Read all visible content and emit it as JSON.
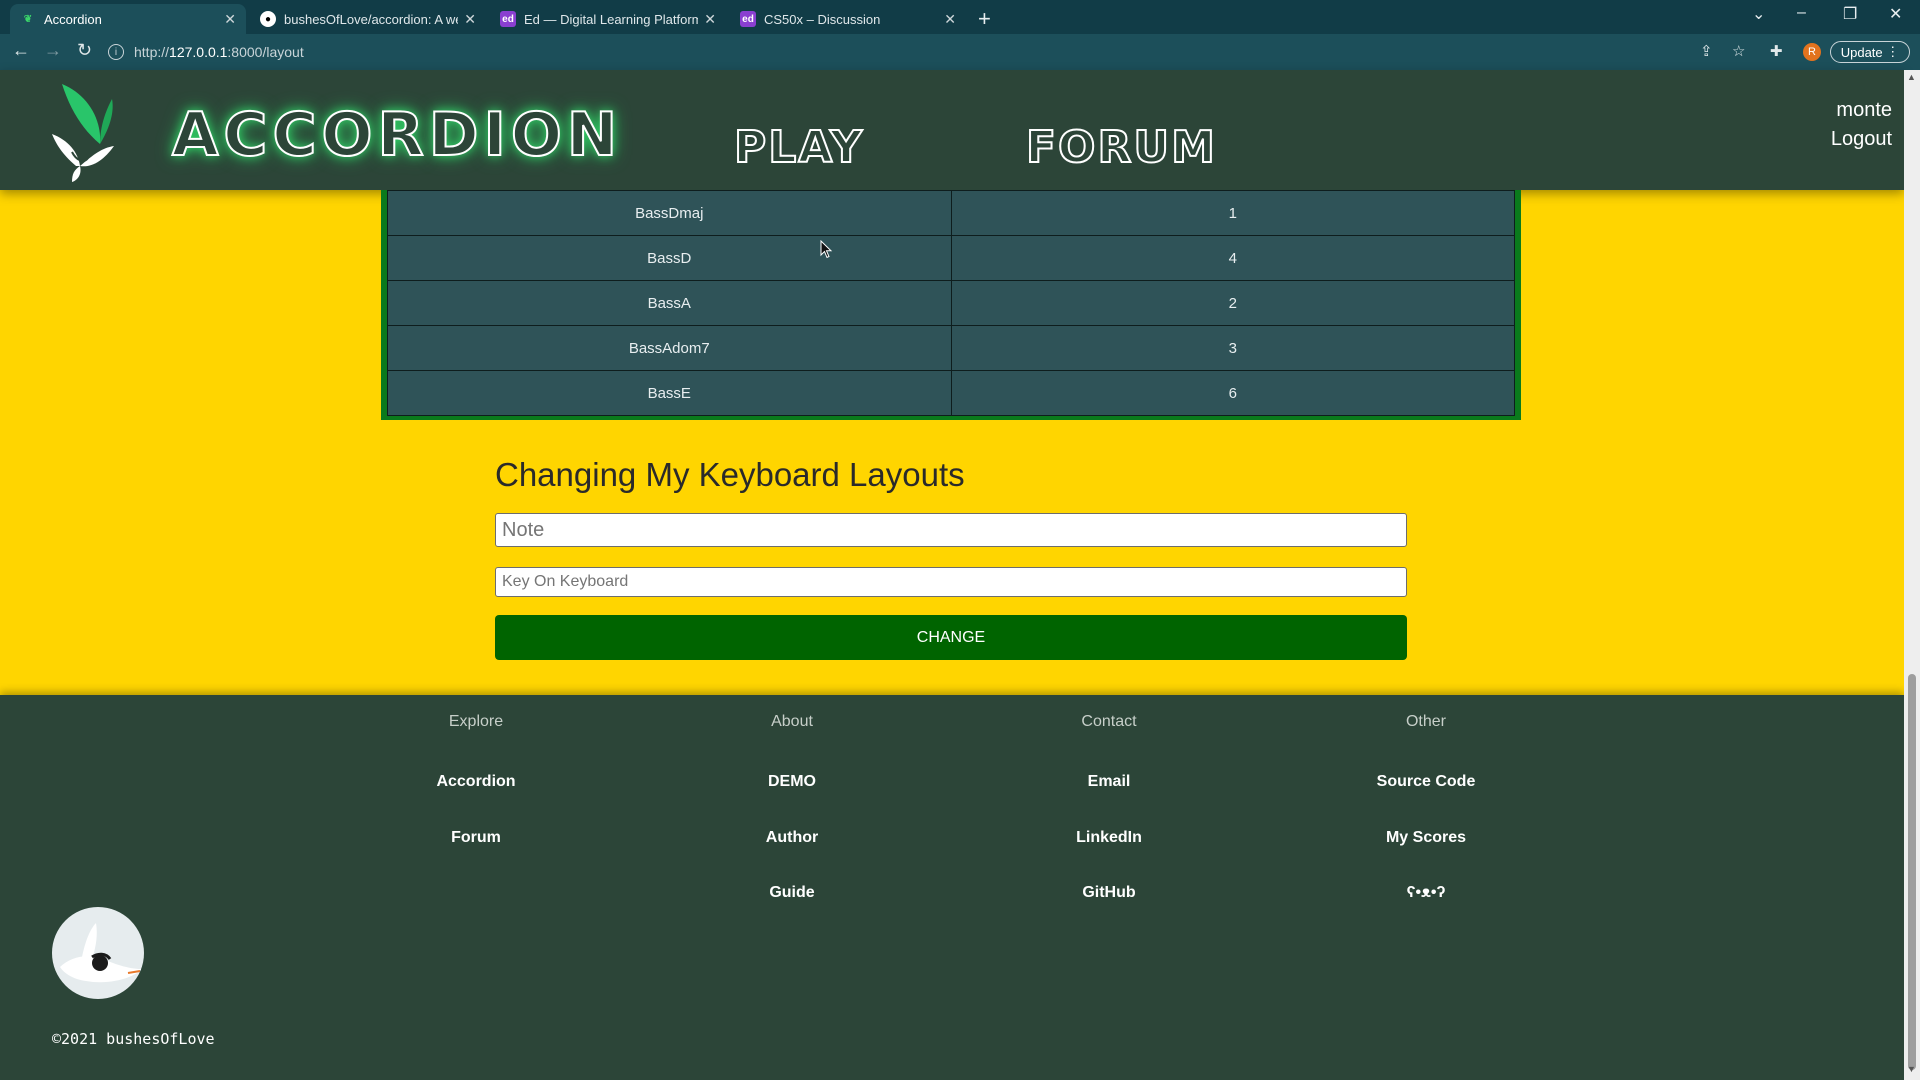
{
  "browser": {
    "tabs": [
      {
        "title": "Accordion",
        "active": true
      },
      {
        "title": "bushesOfLove/accordion: A web",
        "active": false
      },
      {
        "title": "Ed — Digital Learning Platform",
        "active": false
      },
      {
        "title": "CS50x – Discussion",
        "active": false
      }
    ],
    "url_prefix": "http://",
    "url_host": "127.0.0.1",
    "url_rest": ":8000/layout",
    "profile_initial": "R",
    "update_label": "Update"
  },
  "header": {
    "brand": "ACCORDION",
    "nav": [
      "PLAY",
      "FORUM"
    ],
    "username": "monte",
    "logout": "Logout"
  },
  "layout_table": [
    {
      "note": "BassDmaj",
      "key": "1"
    },
    {
      "note": "BassD",
      "key": "4"
    },
    {
      "note": "BassA",
      "key": "2"
    },
    {
      "note": "BassAdom7",
      "key": "3"
    },
    {
      "note": "BassE",
      "key": "6"
    }
  ],
  "form": {
    "title": "Changing My Keyboard Layouts",
    "note_placeholder": "Note",
    "key_placeholder": "Key On Keyboard",
    "button": "CHANGE"
  },
  "footer": {
    "columns": [
      {
        "heading": "Explore",
        "links": [
          "Accordion",
          "Forum"
        ]
      },
      {
        "heading": "About",
        "links": [
          "DEMO",
          "Author",
          "Guide"
        ]
      },
      {
        "heading": "Contact",
        "links": [
          "Email",
          "LinkedIn",
          "GitHub"
        ]
      },
      {
        "heading": "Other",
        "links": [
          "Source Code",
          "My Scores",
          "ʕ•ᴥ•ʔ"
        ]
      }
    ],
    "copyright": "©2021 bushesOfLove"
  },
  "colors": {
    "page_background": "#ffd500",
    "header_footer": "#2c4538",
    "table_border": "#0a7a1c",
    "button": "#006400"
  }
}
